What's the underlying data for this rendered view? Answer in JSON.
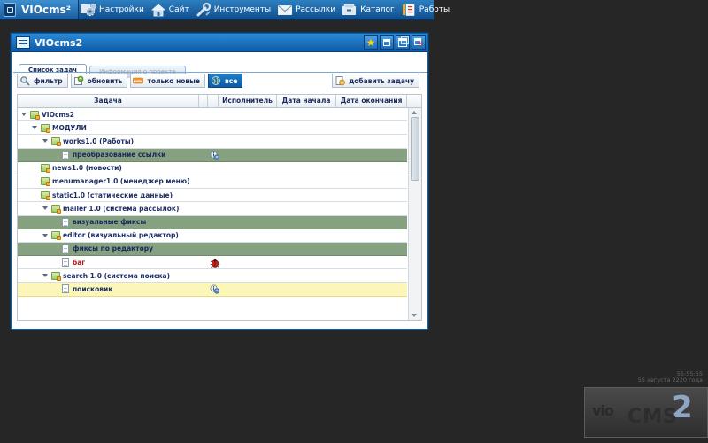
{
  "topbar": {
    "logo": "VIOcms²",
    "menu": [
      {
        "label": "Настройки",
        "icon": "gears-icon"
      },
      {
        "label": "Сайт",
        "icon": "house-icon"
      },
      {
        "label": "Инструменты",
        "icon": "wrench-icon"
      },
      {
        "label": "Рассылки",
        "icon": "envelope-icon"
      },
      {
        "label": "Каталог",
        "icon": "catalog-icon"
      },
      {
        "label": "Работы",
        "icon": "tasks-icon"
      }
    ]
  },
  "window": {
    "title": "VIOcms2",
    "tabs": [
      {
        "label": "Список задач",
        "active": true
      },
      {
        "label": "Информация о проекте",
        "active": false
      }
    ],
    "toolbar": {
      "filter": "фильтр",
      "refresh": "обновить",
      "only_new": "только новые",
      "all": "все",
      "add_task": "добавить задачу"
    },
    "columns": [
      "Задача",
      "",
      "",
      "Исполнитель",
      "Дата начала",
      "Дата окончания"
    ],
    "rows": [
      {
        "label": "VIOcms2",
        "indent": 0,
        "type": "folder",
        "expanded": true,
        "style": "normal",
        "status": ""
      },
      {
        "label": "МОДУЛИ",
        "indent": 1,
        "type": "folder",
        "expanded": true,
        "style": "normal",
        "status": ""
      },
      {
        "label": "works1.0 (Работы)",
        "indent": 2,
        "type": "folder",
        "expanded": true,
        "style": "normal",
        "status": ""
      },
      {
        "label": "преобразование ссылки",
        "indent": 3,
        "type": "doc",
        "expanded": false,
        "style": "selected",
        "status": "info-icon"
      },
      {
        "label": "news1.0 (новости)",
        "indent": 1,
        "type": "folder",
        "expanded": false,
        "style": "normal",
        "status": ""
      },
      {
        "label": "menumanager1.0 (менеджер меню)",
        "indent": 1,
        "type": "folder",
        "expanded": false,
        "style": "normal",
        "status": ""
      },
      {
        "label": "static1.0 (статические данные)",
        "indent": 1,
        "type": "folder",
        "expanded": false,
        "style": "normal",
        "status": ""
      },
      {
        "label": "mailer 1.0 (система рассылок)",
        "indent": 2,
        "type": "folder",
        "expanded": true,
        "style": "normal",
        "status": ""
      },
      {
        "label": "визуальные фиксы",
        "indent": 3,
        "type": "doc",
        "expanded": false,
        "style": "selected",
        "status": ""
      },
      {
        "label": "editor (визуальный редактор)",
        "indent": 2,
        "type": "folder",
        "expanded": true,
        "style": "normal",
        "status": ""
      },
      {
        "label": "фиксы по редактору",
        "indent": 3,
        "type": "doc",
        "expanded": false,
        "style": "selected",
        "status": ""
      },
      {
        "label": "баг",
        "indent": 3,
        "type": "doc",
        "expanded": false,
        "style": "bug",
        "status": "bug-icon"
      },
      {
        "label": "search 1.0 (система поиска)",
        "indent": 2,
        "type": "folder",
        "expanded": true,
        "style": "normal",
        "status": ""
      },
      {
        "label": "поисковик",
        "indent": 3,
        "type": "doc",
        "expanded": false,
        "style": "highlight",
        "status": "info-icon"
      }
    ]
  },
  "clock": {
    "time": "55:55:55",
    "date": "55 августа 2220 года"
  },
  "bg_logo": {
    "vio": "vio",
    "cms": "CMS",
    "sup": "2"
  },
  "colors": {
    "accent": "#0e5aa6",
    "selected_row": "#85a17f",
    "highlight_row": "#fcf6b8",
    "background": "#262626"
  }
}
